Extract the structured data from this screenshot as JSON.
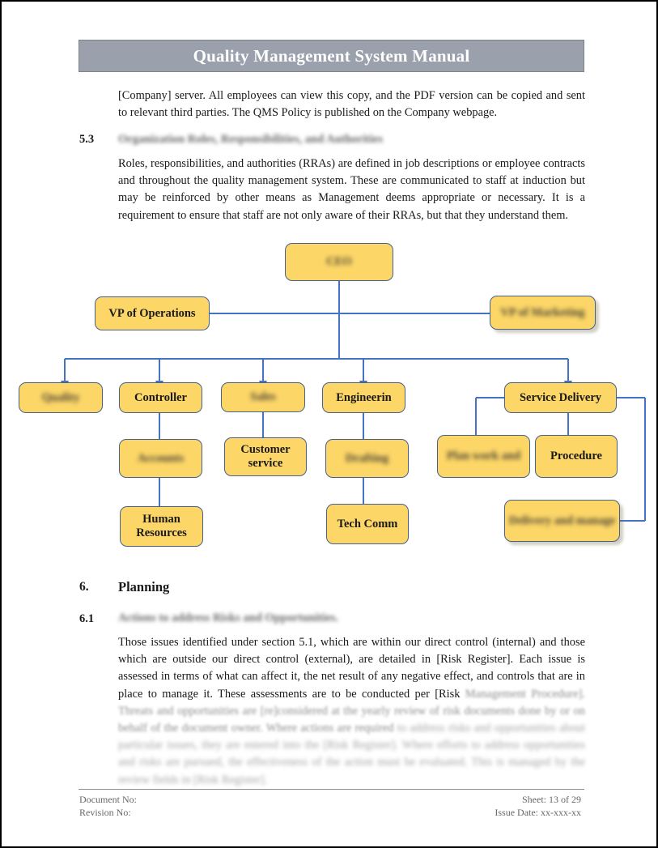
{
  "header": {
    "title": "Quality Management System Manual"
  },
  "intro_paragraph": "[Company] server. All employees can view this copy, and the PDF version can be copied and sent to relevant third parties. The QMS Policy is published on the Company webpage.",
  "section_53": {
    "number": "5.3",
    "heading": "Organization Roles, Responsibilities, and Authorities",
    "paragraph": "Roles, responsibilities, and authorities (RRAs) are defined in job descriptions or employee contracts and throughout the quality management system. These are communicated to staff at induction but may be reinforced by other means as Management deems appropriate or necessary. It is a requirement to ensure that staff are not only aware of their RRAs, but that they understand them."
  },
  "section_6": {
    "number": "6.",
    "heading": "Planning"
  },
  "section_61": {
    "number": "6.1",
    "heading": "Actions to address Risks and Opportunities.",
    "paragraph_clear": "Those issues identified under section 5.1, which are within our direct control (internal) and those which are outside our direct control (external), are detailed in [Risk Register]. Each issue is assessed in terms of what can affect it, the net result of any negative effect, and controls that are in place to manage it. These assessments are to be conducted per [Risk",
    "paragraph_fade1": " Management Procedure]. Threats and opportunities are [re]considered at the yearly review of risk documents done by or on behalf of the document owner. Where actions are required",
    "paragraph_fade2": " to address risks and opportunities about particular issues, they are entered into the [Risk Register]. Where efforts to address opportunities and risks are pursued, the effectiveness of the action must be evaluated. This is managed by the review fields in [Risk Register]."
  },
  "org_chart": {
    "nodes": [
      {
        "id": "ceo",
        "label": "CEO",
        "blurred": true
      },
      {
        "id": "vp-operations",
        "label": "VP of Operations",
        "blurred": false
      },
      {
        "id": "vp-marketing",
        "label": "VP of Marketing",
        "blurred": true
      },
      {
        "id": "quality",
        "label": "Quality",
        "blurred": true
      },
      {
        "id": "controller",
        "label": "Controller",
        "blurred": false
      },
      {
        "id": "sales",
        "label": "Sales",
        "blurred": true
      },
      {
        "id": "engineering",
        "label": "Engineerin",
        "blurred": false
      },
      {
        "id": "service-delivery",
        "label": "Service Delivery",
        "blurred": false
      },
      {
        "id": "accounts",
        "label": "Accounts",
        "blurred": true
      },
      {
        "id": "customer-service",
        "label": "Customer service",
        "blurred": false
      },
      {
        "id": "drafting",
        "label": "Drafting",
        "blurred": true
      },
      {
        "id": "plan-work",
        "label": "Plan work and",
        "blurred": true
      },
      {
        "id": "procedure",
        "label": "Procedure",
        "blurred": false
      },
      {
        "id": "human-resources",
        "label": "Human Resources",
        "blurred": false
      },
      {
        "id": "tech-comm",
        "label": "Tech Comm",
        "blurred": false
      },
      {
        "id": "delivery-manage",
        "label": "Delivery and manage",
        "blurred": true
      }
    ],
    "colors": {
      "node_fill": "#FCD667",
      "node_border": "#44618F",
      "connector": "#4472C4"
    }
  },
  "footer": {
    "document_no": "Document No:",
    "revision_no": "Revision No:",
    "sheet": "Sheet: 13 of 29",
    "issue_date": "Issue Date: xx-xxx-xx"
  }
}
